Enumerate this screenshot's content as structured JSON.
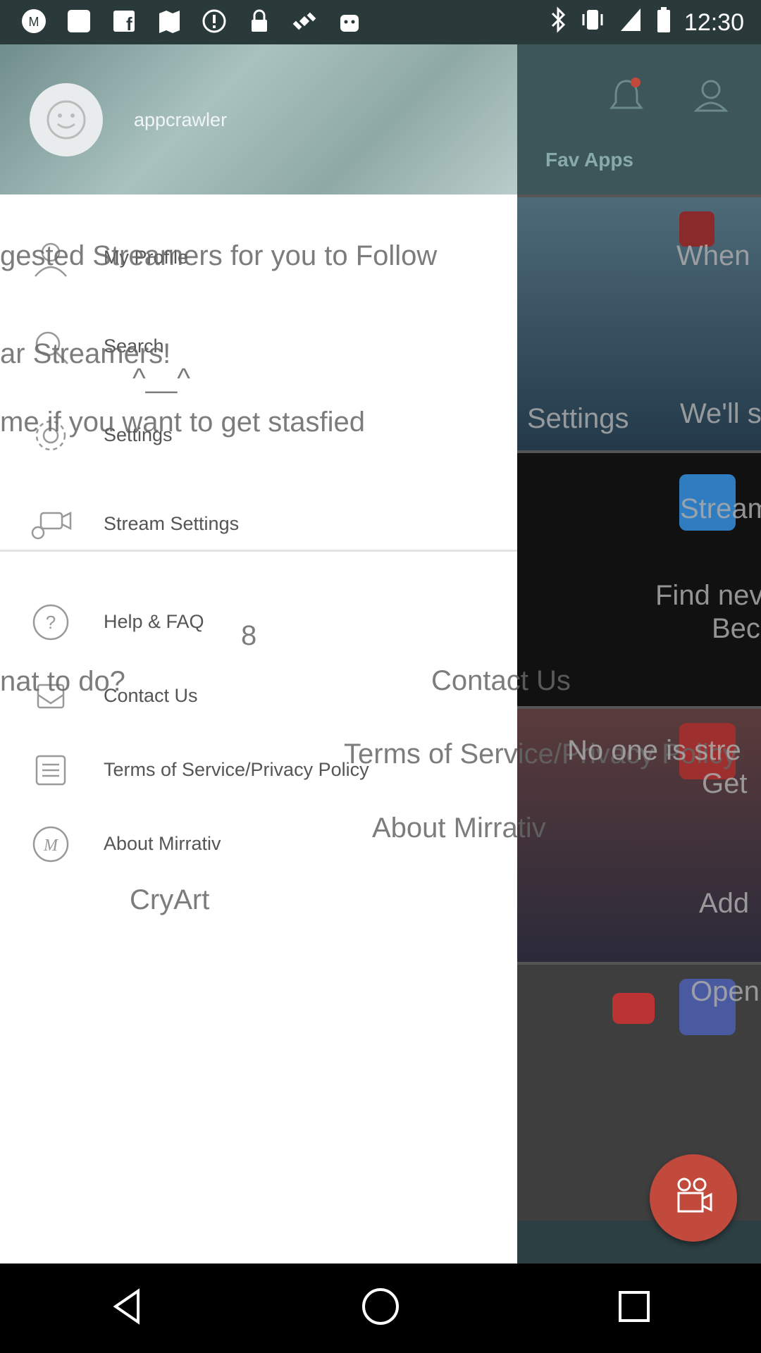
{
  "status_bar": {
    "time": "12:30"
  },
  "drawer": {
    "username": "appcrawler",
    "menu": [
      {
        "label": "My Profile",
        "icon": "person-icon"
      },
      {
        "label": "Search",
        "icon": "search-icon"
      },
      {
        "label": "Settings",
        "icon": "gear-icon"
      },
      {
        "label": "Stream Settings",
        "icon": "stream-settings-icon"
      },
      {
        "label": "Help & FAQ",
        "icon": "help-icon"
      },
      {
        "label": "Contact Us",
        "icon": "mail-icon"
      },
      {
        "label": "Terms of Service/Privacy Policy",
        "icon": "document-icon"
      },
      {
        "label": "About Mirrativ",
        "icon": "mirrativ-icon"
      }
    ]
  },
  "background": {
    "fav_apps": "Fav Apps",
    "ghost_texts": {
      "suggested": "gested Streamers for you to Follow",
      "when": "When",
      "popular": "ar Streamers!",
      "face": "^__^",
      "stasfied": "me if you want to get stasfied",
      "settings": "Settings",
      "well": "We'll s",
      "stream": "Stream",
      "find": "Find nev",
      "bec": "Bec",
      "eight": "8",
      "what_to_do": "nat to do?",
      "contact_us": "Contact Us",
      "terms": "Terms of Service/Privacy Policy",
      "no_one": "No one is stre",
      "get": "Get",
      "about": "About Mirrativ",
      "cryart": "CryArt",
      "add": "Add",
      "open": "Open"
    }
  },
  "colors": {
    "fab": "#c14a3d",
    "status_bar": "#2a3a3a",
    "drawer_bg": "#ffffff"
  }
}
